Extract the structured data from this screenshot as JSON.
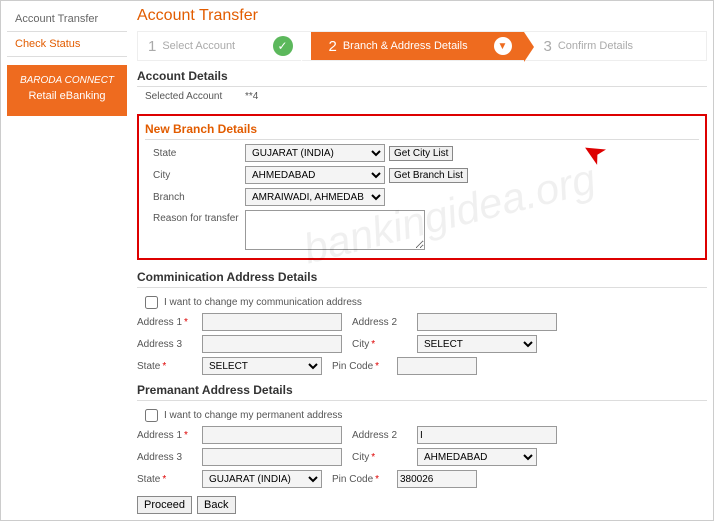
{
  "sidebar": {
    "link1": "Account Transfer",
    "link2": "Check Status",
    "brand_top": "BARODA CONNECT",
    "brand_bot": "Retail eBanking"
  },
  "title": "Account Transfer",
  "steps": {
    "n1": "1",
    "s1": "Select Account",
    "n2": "2",
    "s2": "Branch & Address Details",
    "n3": "3",
    "s3": "Confirm Details"
  },
  "acc": {
    "h": "Account Details",
    "lbl": "Selected Account",
    "val": "**4"
  },
  "nb": {
    "h": "New Branch Details",
    "state_l": "State",
    "state_v": "GUJARAT (INDIA)",
    "state_btn": "Get City List",
    "city_l": "City",
    "city_v": "AHMEDABAD",
    "city_btn": "Get Branch List",
    "branch_l": "Branch",
    "branch_v": "AMRAIWADI, AHMEDAB",
    "reason_l": "Reason for transfer"
  },
  "comm": {
    "h": "Comminication Address Details",
    "chk": "I want to change my communication address",
    "a1": "Address 1",
    "a2": "Address 2",
    "a3": "Address 3",
    "city_l": "City",
    "city_v": "SELECT",
    "state_l": "State",
    "state_v": "SELECT",
    "pin_l": "Pin Code"
  },
  "perm": {
    "h": "Premanant Address Details",
    "chk": "I want to change my permanent address",
    "a1": "Address 1",
    "a2": "Address 2",
    "a3": "Address 3",
    "city_l": "City",
    "city_v": "AHMEDABAD",
    "state_l": "State",
    "state_v": "GUJARAT (INDIA)",
    "pin_l": "Pin Code",
    "pin_v": "380026"
  },
  "btn": {
    "proceed": "Proceed",
    "back": "Back"
  },
  "watermark": "bankingidea.org"
}
